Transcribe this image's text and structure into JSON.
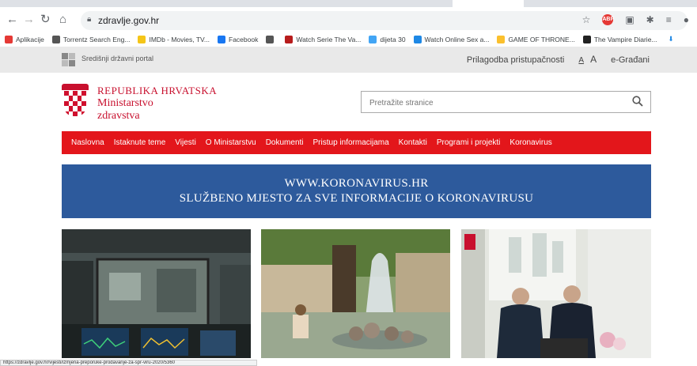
{
  "browser": {
    "url": "zdravlje.gov.hr",
    "bookmarks": [
      {
        "label": "Aplikacije",
        "icon": "apps-grid-icon",
        "color": "#e53935"
      },
      {
        "label": "Torrentz Search Eng...",
        "icon": "globe-icon",
        "color": "#555555"
      },
      {
        "label": "IMDb - Movies, TV...",
        "icon": "imdb-icon",
        "color": "#f5c518"
      },
      {
        "label": "Facebook",
        "icon": "facebook-icon",
        "color": "#1877f2"
      },
      {
        "label": "",
        "icon": "globe-icon",
        "color": "#555555"
      },
      {
        "label": "Watch Serie The Va...",
        "icon": "sw-icon",
        "color": "#b71c1c"
      },
      {
        "label": "dijeta 30",
        "icon": "360-icon",
        "color": "#42a5f5"
      },
      {
        "label": "Watch Online Sex a...",
        "icon": "puzzle-icon",
        "color": "#1e88e5"
      },
      {
        "label": "GAME OF THRONE...",
        "icon": "star-icon",
        "color": "#fbc02d"
      },
      {
        "label": "The Vampire Diarie...",
        "icon": "bat-icon",
        "color": "#212121"
      }
    ]
  },
  "portal": {
    "name": "Središnji državni portal",
    "accessibility": "Prilagodba pristupačnosti",
    "font_small": "A",
    "font_large": "A",
    "egradjani": "e-Građani"
  },
  "header": {
    "line1": "REPUBLIKA HRVATSKA",
    "line2": "Ministarstvo",
    "line3": "zdravstva",
    "search_placeholder": "Pretražite stranice"
  },
  "nav": [
    "Naslovna",
    "Istaknute teme",
    "Vijesti",
    "O Ministarstvu",
    "Dokumenti",
    "Pristup informacijama",
    "Kontakti",
    "Programi i projekti",
    "Koronavirus"
  ],
  "banner": {
    "line1": "WWW.KORONAVIRUS.HR",
    "line2": "SLUŽBENO MJESTO ZA SVE INFORMACIJE O KORONAVIRUSU"
  },
  "status_url": "https://zdravlje.gov.hr/vijesti/izmjena-preporuke-prodavanje-za-spr-viru-2020/5360",
  "colors": {
    "nav_red": "#e3161b",
    "banner_blue": "#2d5a9c",
    "ministry_red": "#c8102e"
  }
}
